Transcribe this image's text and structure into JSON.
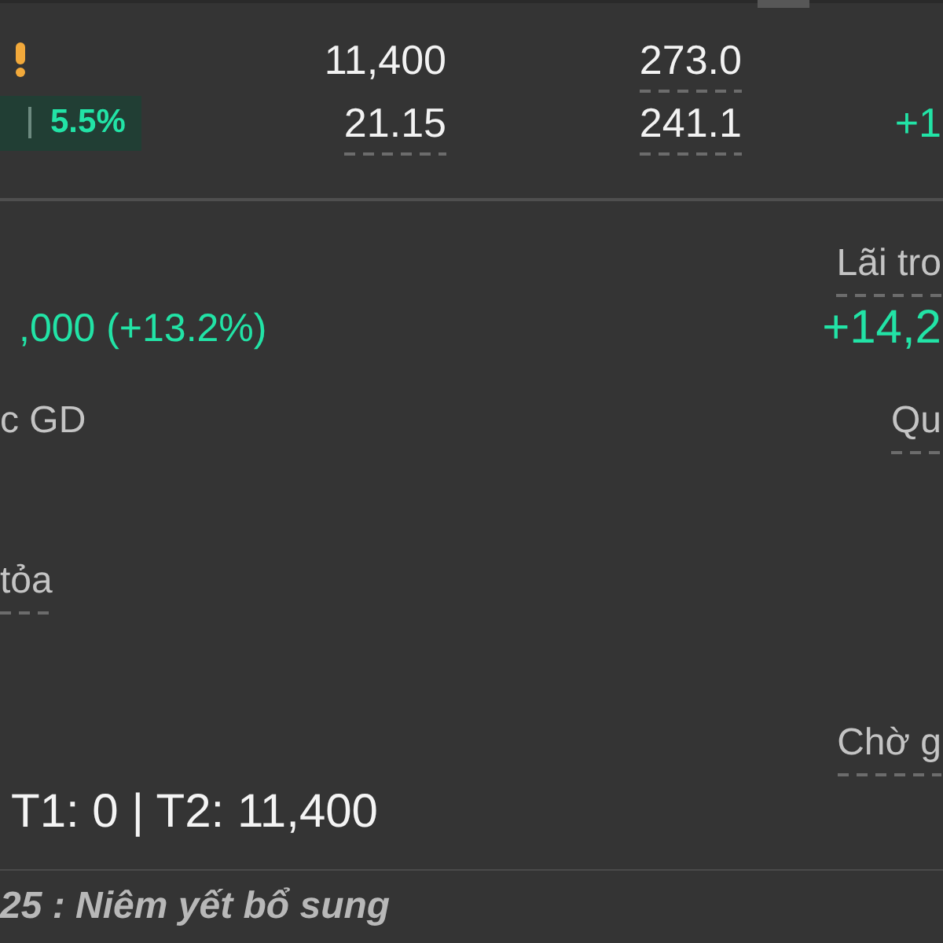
{
  "price_rows": [
    {
      "marker": {
        "kind": "warning"
      },
      "col_2": {
        "text": "11,400",
        "underlined": false
      },
      "col_3": {
        "text": "273.0",
        "underlined": true
      }
    },
    {
      "marker": {
        "kind": "badge",
        "text": "5.5%"
      },
      "col_2": {
        "text": "21.15",
        "underlined": true
      },
      "col_3": {
        "text": "241.1",
        "underlined": true
      },
      "col_4": {
        "text": "+1"
      }
    }
  ],
  "summary_rows": [
    {
      "right": {
        "kind": "label",
        "text": "Lãi tro",
        "underlined": true
      }
    },
    {
      "left": {
        "kind": "gain",
        "text": ",000 (+13.2%)"
      },
      "right": {
        "kind": "gain_large",
        "text": "+14,2"
      }
    },
    {
      "left": {
        "kind": "label",
        "text": "c GD",
        "underlined": false
      },
      "right": {
        "kind": "label",
        "text": "Qu",
        "underlined": true
      }
    },
    {
      "left": {
        "kind": "label",
        "text": "tỏa",
        "underlined": true
      }
    },
    {
      "right": {
        "kind": "label",
        "text": "Chờ g",
        "underlined": true
      }
    },
    {
      "left": {
        "kind": "value_large",
        "text": "T1: 0 | T2: 11,400"
      }
    }
  ],
  "notice": "25 : Niêm yết bổ sung"
}
